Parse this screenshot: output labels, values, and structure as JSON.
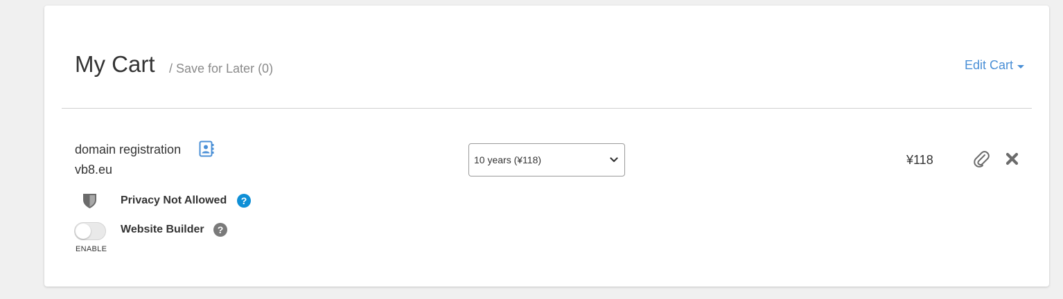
{
  "header": {
    "title": "My Cart",
    "save_for_later": "/ Save for Later (0)",
    "edit_cart_label": "Edit Cart"
  },
  "cart_item": {
    "product": "domain registration",
    "domain": "vb8.eu",
    "term_selected": "10 years (¥118)",
    "price": "¥118",
    "features": {
      "privacy_label": "Privacy Not Allowed",
      "builder_label": "Website Builder",
      "builder_toggle_caption": "ENABLE",
      "builder_enabled": false
    }
  },
  "icons": {
    "contact": "contact-card-icon",
    "privacy": "shield-icon",
    "help": "question-circle-icon",
    "attach": "paperclip-icon",
    "remove": "close-x-icon",
    "dropdown": "chevron-down-icon",
    "edit_caret": "caret-down-icon"
  },
  "colors": {
    "link": "#4a8fd6",
    "help_active": "#0f8fd6",
    "help_muted": "#7a7a7a",
    "icon_gray": "#6b6b6b"
  }
}
